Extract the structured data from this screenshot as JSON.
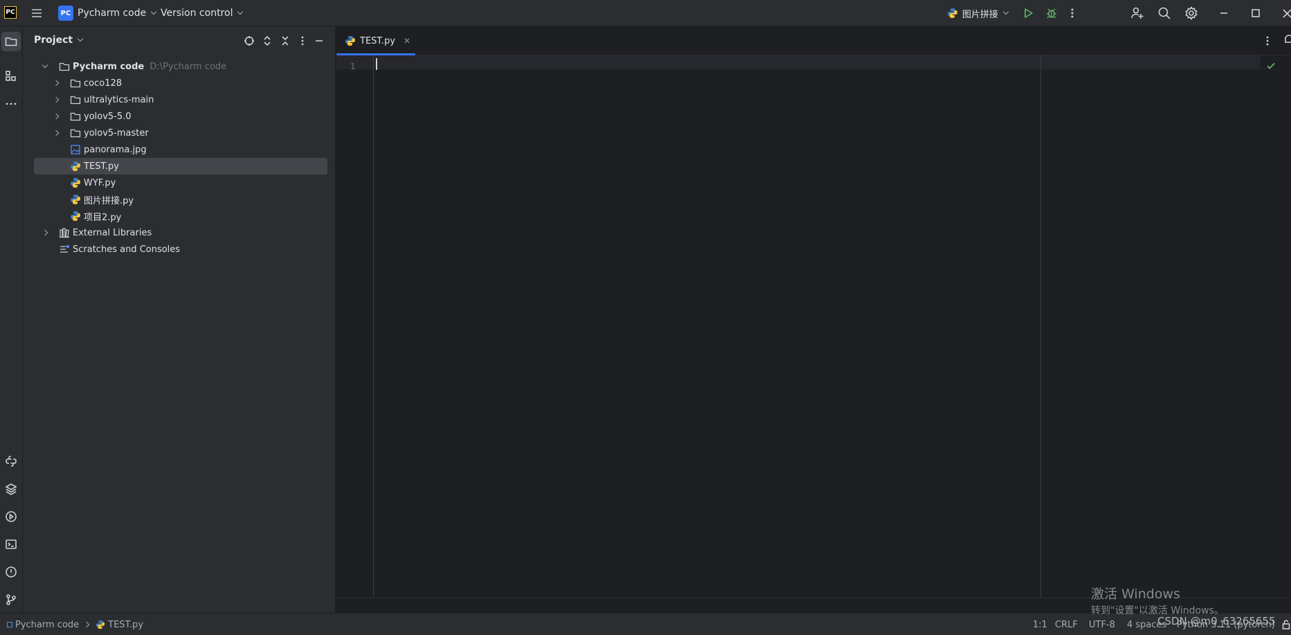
{
  "titlebar": {
    "app_icon": "PC",
    "project_badge": "PC",
    "project_name": "Pycharm code",
    "vcs_label": "Version control",
    "run_config": "图片拼接",
    "icons": [
      "hamburger-menu-icon",
      "run-icon",
      "debug-icon",
      "more-vert-icon",
      "add-user-icon",
      "search-icon",
      "settings-gear-icon",
      "minimize-icon",
      "maximize-icon",
      "close-icon"
    ]
  },
  "toolstrip": {
    "icons": [
      "project-folder-icon",
      "structure-icon",
      "more-tools-icon",
      "python-console-icon",
      "layers-icon",
      "services-icon",
      "terminal-icon",
      "problems-icon",
      "git-icon"
    ]
  },
  "project_panel": {
    "title": "Project",
    "tree": [
      {
        "label": "Pycharm code",
        "path": "D:\\Pycharm code",
        "type": "folder",
        "expanded": true,
        "level": 0
      },
      {
        "label": "coco128",
        "type": "folder",
        "expanded": false,
        "level": 1
      },
      {
        "label": "ultralytics-main",
        "type": "folder",
        "expanded": false,
        "level": 1
      },
      {
        "label": "yolov5-5.0",
        "type": "folder",
        "expanded": false,
        "level": 1
      },
      {
        "label": "yolov5-master",
        "type": "folder",
        "expanded": false,
        "level": 1
      },
      {
        "label": "panorama.jpg",
        "type": "image",
        "level": 1
      },
      {
        "label": "TEST.py",
        "type": "python",
        "level": 1,
        "selected": true
      },
      {
        "label": "WYF.py",
        "type": "python",
        "level": 1
      },
      {
        "label": "图片拼接.py",
        "type": "python",
        "level": 1
      },
      {
        "label": "项目2.py",
        "type": "python",
        "level": 1
      },
      {
        "label": "External Libraries",
        "type": "library",
        "expanded": false,
        "level": 0
      },
      {
        "label": "Scratches and Consoles",
        "type": "scratches",
        "level": 0
      }
    ]
  },
  "editor": {
    "tab_label": "TEST.py",
    "line_numbers": [
      "1"
    ]
  },
  "statusbar": {
    "breadcrumb_project": "Pycharm code",
    "breadcrumb_file": "TEST.py",
    "position": "1:1",
    "line_ending": "CRLF",
    "encoding": "UTF-8",
    "indent": "4 spaces",
    "interpreter": "Python 3.11 (pytorch)"
  },
  "watermark": {
    "title": "激活 Windows",
    "subtitle": "转到\"设置\"以激活 Windows。",
    "csdn": "CSDN @m0_63265655"
  },
  "colors": {
    "accent": "#3574f0",
    "panel_bg": "#2b2d30",
    "editor_bg": "#1e1f22",
    "run_green": "#5fb865"
  }
}
